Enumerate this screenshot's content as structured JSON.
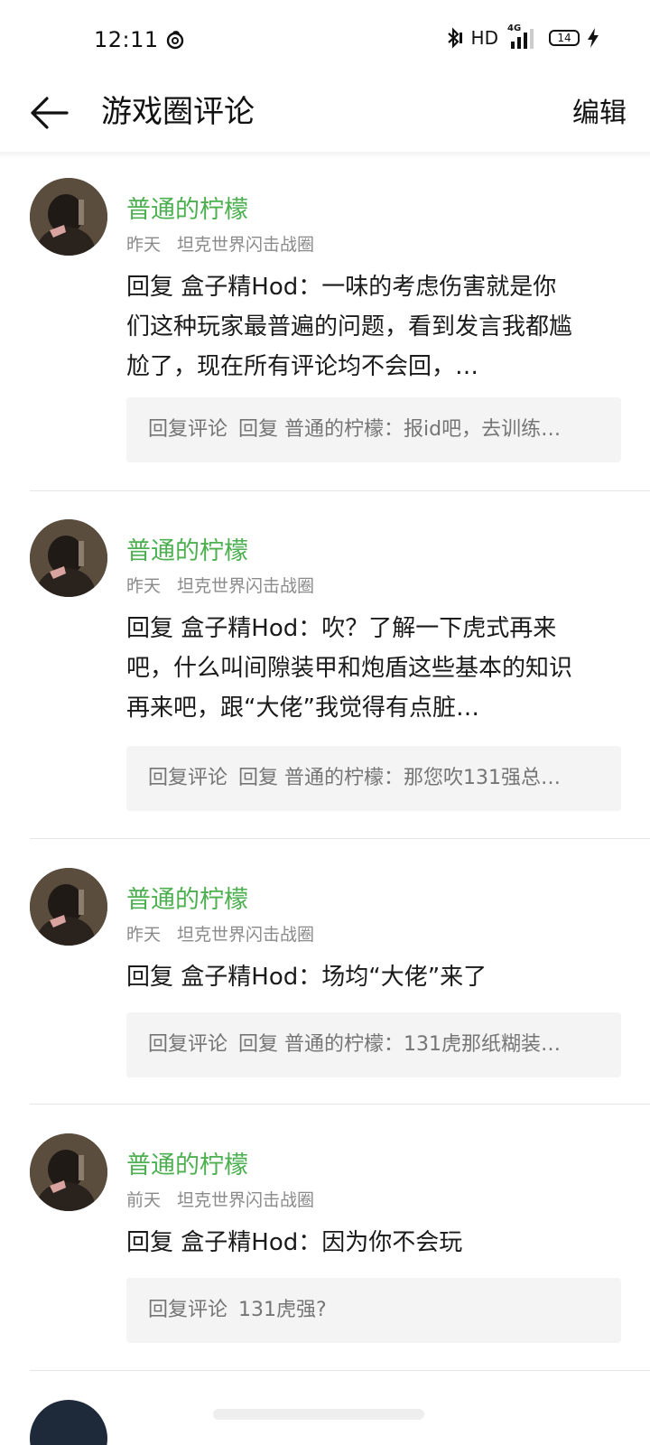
{
  "status_bar": {
    "time": "12:11",
    "network_label": "HD",
    "signal_label": "4G",
    "battery_level": "14"
  },
  "header": {
    "title": "游戏圈评论",
    "edit_label": "编辑"
  },
  "colors": {
    "username": "#4caf50",
    "meta": "#8a8a8a",
    "quote_bg": "#f4f4f4"
  },
  "comments": [
    {
      "username": "普通的柠檬",
      "time": "昨天",
      "circle": "坦克世界闪击战圈",
      "text": "回复 盒子精Hod：一味的考虑伤害就是你们这种玩家最普遍的问题，看到发言我都尴尬了，现在所有评论均不会回，…",
      "quote_tag": "回复评论",
      "quote_text": "回复 普通的柠檬：报id吧，去训练…"
    },
    {
      "username": "普通的柠檬",
      "time": "昨天",
      "circle": "坦克世界闪击战圈",
      "text": "回复 盒子精Hod：吹？了解一下虎式再来吧，什么叫间隙装甲和炮盾这些基本的知识再来吧，跟“大佬”我觉得有点脏…",
      "quote_tag": "回复评论",
      "quote_text": "回复 普通的柠檬：那您吹131强总…"
    },
    {
      "username": "普通的柠檬",
      "time": "昨天",
      "circle": "坦克世界闪击战圈",
      "text": "回复 盒子精Hod：场均“大佬”来了",
      "quote_tag": "回复评论",
      "quote_text": "回复 普通的柠檬：131虎那纸糊装…"
    },
    {
      "username": "普通的柠檬",
      "time": "前天",
      "circle": "坦克世界闪击战圈",
      "text": "回复 盒子精Hod：因为你不会玩",
      "quote_tag": "回复评论",
      "quote_text": "131虎强?"
    }
  ]
}
